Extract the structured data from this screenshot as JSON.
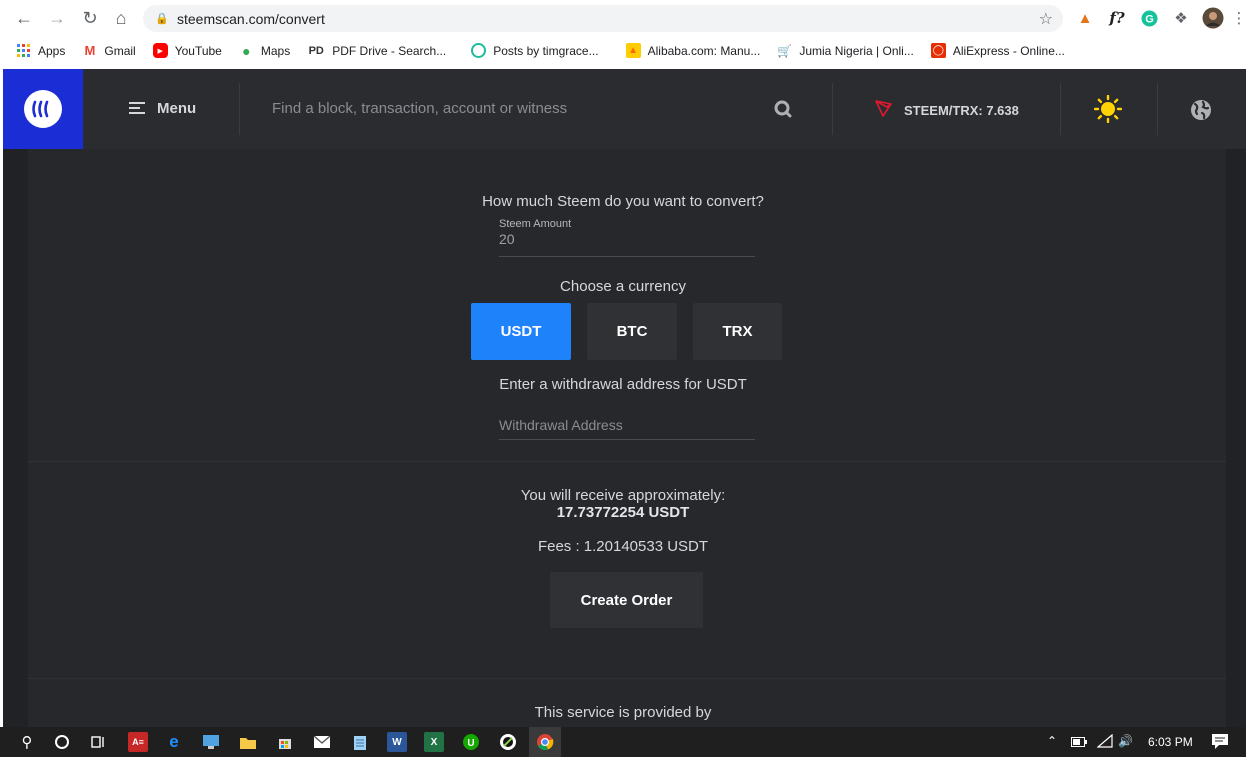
{
  "browser": {
    "url": "steemscan.com/convert",
    "bookmarks": [
      {
        "label": "Apps",
        "icon": "apps-grid-icon",
        "color": "#4285f4"
      },
      {
        "label": "Gmail",
        "icon": "gmail-icon",
        "color": "#ea4335"
      },
      {
        "label": "YouTube",
        "icon": "youtube-icon",
        "color": "#ff0000"
      },
      {
        "label": "Maps",
        "icon": "maps-icon",
        "color": "#34a853"
      },
      {
        "label": "PDF Drive - Search...",
        "icon": "pdf-drive-icon",
        "color": "#333333"
      },
      {
        "label": "Posts by timgrace...",
        "icon": "posts-icon",
        "color": "#1ebc9c"
      },
      {
        "label": "Alibaba.com: Manu...",
        "icon": "alibaba-icon",
        "color": "#ff6a00"
      },
      {
        "label": "Jumia Nigeria | Onli...",
        "icon": "jumia-icon",
        "color": "#f68b1e"
      },
      {
        "label": "AliExpress - Online...",
        "icon": "aliexpress-icon",
        "color": "#e62e04"
      }
    ],
    "ext_fx": "f?"
  },
  "header": {
    "menu_label": "Menu",
    "search_placeholder": "Find a block, transaction, account or witness",
    "price": "STEEM/TRX: 7.638",
    "brand_color": "#1b2ed6"
  },
  "convert": {
    "question": "How much Steem do you want to convert?",
    "amount_label": "Steem Amount",
    "amount_value": "20",
    "choose_currency": "Choose a currency",
    "currencies": [
      "USDT",
      "BTC",
      "TRX"
    ],
    "selected_currency": "USDT",
    "withdrawal_prompt": "Enter a withdrawal address for USDT",
    "withdrawal_placeholder": "Withdrawal Address",
    "receive_label": "You will receive approximately:",
    "receive_amount": "17.73772254 USDT",
    "fees": "Fees : 1.20140533 USDT",
    "create_order": "Create Order",
    "provided_by": "This service is provided by",
    "accent_color": "#1e82fb"
  },
  "taskbar": {
    "time": "6:03 PM"
  }
}
